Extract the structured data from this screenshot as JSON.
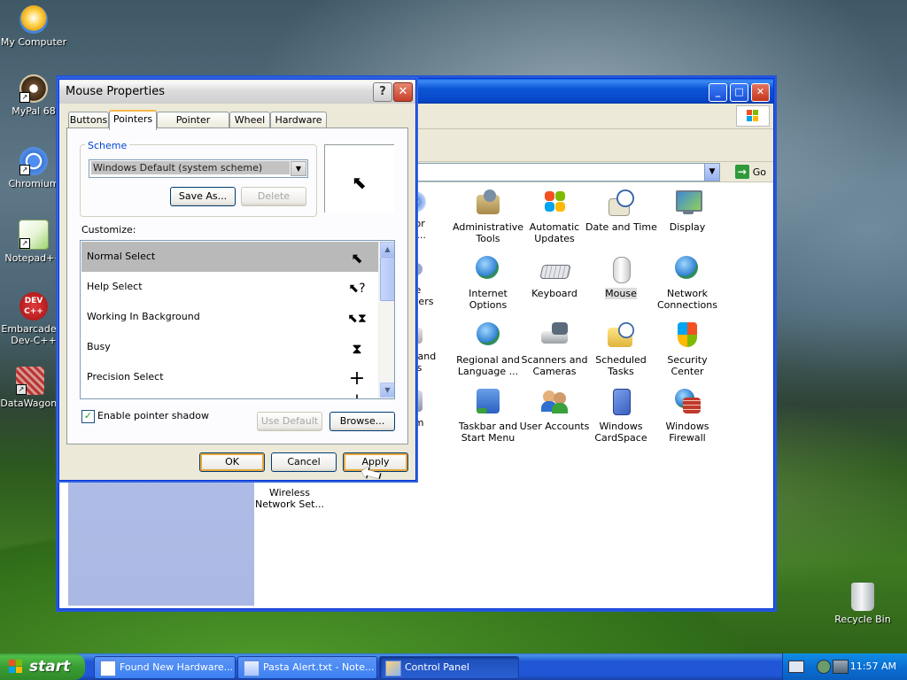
{
  "desktop": {
    "icons": [
      {
        "label": "My Computer"
      },
      {
        "label": "MyPal 68"
      },
      {
        "label": "Chromium"
      },
      {
        "label": "Notepad++"
      },
      {
        "label": "Embarcadero Dev-C++"
      },
      {
        "label": "DataWagon."
      },
      {
        "label": "Recycle Bin"
      }
    ],
    "dev_badge": "DEV",
    "dev_badge2": "C++"
  },
  "control_panel": {
    "address_go": "Go",
    "items": [
      {
        "label": "dd or\nnov..."
      },
      {
        "label": "Administrative\nTools"
      },
      {
        "label": "Automatic\nUpdates"
      },
      {
        "label": "Date and Time"
      },
      {
        "label": "Display"
      },
      {
        "label": "ame\ntrollers"
      },
      {
        "label": "Internet\nOptions"
      },
      {
        "label": "Keyboard"
      },
      {
        "label": "Mouse"
      },
      {
        "label": "Network\nConnections"
      },
      {
        "label": "ers and\naxes"
      },
      {
        "label": "Regional and\nLanguage ..."
      },
      {
        "label": "Scanners and\nCameras"
      },
      {
        "label": "Scheduled\nTasks"
      },
      {
        "label": "Security\nCenter"
      },
      {
        "label": "stem"
      },
      {
        "label": "Taskbar and\nStart Menu"
      },
      {
        "label": "User Accounts"
      },
      {
        "label": "Windows\nCardSpace"
      },
      {
        "label": "Windows\nFirewall"
      },
      {
        "label": "Wireless\nNetwork Set..."
      }
    ]
  },
  "dialog": {
    "title": "Mouse Properties",
    "help": "?",
    "close": "✕",
    "tabs": [
      {
        "label": "Buttons"
      },
      {
        "label": "Pointers"
      },
      {
        "label": "Pointer Options"
      },
      {
        "label": "Wheel"
      },
      {
        "label": "Hardware"
      }
    ],
    "scheme_label": "Scheme",
    "scheme_value": "Windows Default (system scheme)",
    "save_as": "Save As...",
    "delete": "Delete",
    "customize_label": "Customize:",
    "pointers": [
      {
        "label": "Normal Select",
        "glyph": "⬉"
      },
      {
        "label": "Help Select",
        "glyph": "⬉?"
      },
      {
        "label": "Working In Background",
        "glyph": "⬉⧗"
      },
      {
        "label": "Busy",
        "glyph": "⧗"
      },
      {
        "label": "Precision Select",
        "glyph": "+"
      },
      {
        "label": "",
        "glyph": "I"
      }
    ],
    "enable_shadow": "Enable pointer shadow",
    "use_default": "Use Default",
    "browse": "Browse...",
    "ok": "OK",
    "cancel": "Cancel",
    "apply": "Apply"
  },
  "taskbar": {
    "start": "start",
    "tasks": [
      {
        "label": "Found New Hardware..."
      },
      {
        "label": "Pasta Alert.txt - Note..."
      },
      {
        "label": "Control Panel"
      }
    ],
    "clock": "11:57 AM"
  }
}
